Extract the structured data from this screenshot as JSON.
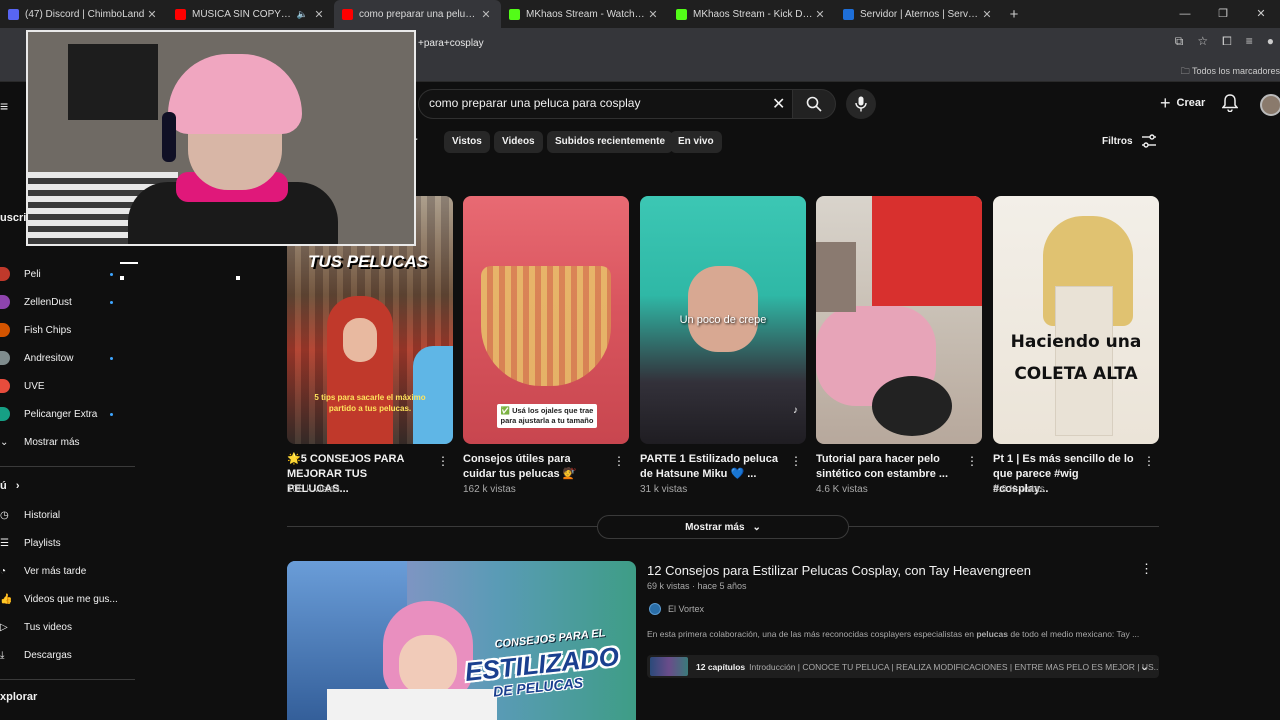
{
  "browser": {
    "tabs": [
      {
        "title": "(47) Discord | ChimboLand",
        "color": "#5865f2"
      },
      {
        "title": "MÚSICA SIN COPYRIGHT",
        "color": "#ff0000",
        "muted": true
      },
      {
        "title": "como preparar una peluca para cosplay",
        "color": "#ff0000",
        "active": true
      },
      {
        "title": "MKhaos Stream - Watch Live on Kick",
        "color": "#53fc18"
      },
      {
        "title": "MKhaos Stream - Kick Dashboard",
        "color": "#53fc18"
      },
      {
        "title": "Servidor | Aternos | Servidor de Minecraft",
        "color": "#1e6fd9"
      }
    ],
    "new_tab": "+",
    "url_visible": "+para+cosplay",
    "bookmarks_all": "Todos los marcadores"
  },
  "header": {
    "search_query": "como preparar una peluca para cosplay",
    "create_label": "Crear"
  },
  "chips": [
    "rar",
    "Vistos",
    "Videos",
    "Subidos recientemente",
    "En vivo"
  ],
  "filters_label": "Filtros",
  "sidebar": {
    "subs_header": "uscrip",
    "subscriptions": [
      {
        "name": "Peli",
        "color": "#c0392b",
        "new": true
      },
      {
        "name": "ZellenDust",
        "color": "#8e44ad",
        "new": true
      },
      {
        "name": "Fish Chips",
        "color": "#d35400",
        "new": false
      },
      {
        "name": "Andresitow",
        "color": "#7f8c8d",
        "new": true
      },
      {
        "name": "UVE",
        "color": "#e74c3c",
        "new": false
      },
      {
        "name": "Pelicanger Extra",
        "color": "#16a085",
        "new": true
      }
    ],
    "show_more": "Mostrar más",
    "you_header": "ú",
    "you_items": [
      "Historial",
      "Playlists",
      "Ver más tarde",
      "Videos que me gus...",
      "Tus videos",
      "Descargas"
    ],
    "explore_header": "xplorar"
  },
  "shorts": [
    {
      "title": "🌟5 CONSEJOS PARA MEJORAR TUS PELUCAS...",
      "views": "108 k vistas",
      "caption_top": "TUS PELUCAS",
      "caption_bottom": "5 tips para sacarle el máximo partido a tus pelucas."
    },
    {
      "title": "Consejos útiles para cuidar tus pelucas 💇",
      "views": "162 k vistas",
      "caption_bottom": "✅ Usá los ojales que trae para ajustarla a tu tamaño"
    },
    {
      "title": "PARTE 1 Estilizado peluca de Hatsune Miku 💙 ...",
      "views": "31 k vistas",
      "caption_mid": "Un poco de crepe"
    },
    {
      "title": "Tutorial para hacer pelo sintético con estambre ...",
      "views": "4.6 K vistas"
    },
    {
      "title": "Pt 1 | Es más sencillo de lo que parece #wig #cosplay...",
      "views": "5.9 K vistas",
      "caption_mid": "Haciendo una COLETA ALTA"
    }
  ],
  "show_more_results": "Mostrar más",
  "long_video": {
    "title": "12 Consejos para Estilizar Pelucas Cosplay, con Tay Heavengreen",
    "meta": "69 k vistas · hace 5 años",
    "channel": "El Vortex",
    "description_pre": "En esta primera colaboración, una de las más reconocidas cosplayers especialistas en ",
    "description_bold": "pelucas",
    "description_post": " de todo el medio mexicano: Tay ...",
    "chapters_count": "12 capítulos",
    "chapters_text": "Introducción | CONOCE TU PELUCA | REALIZA MODIFICACIONES | ENTRE MAS PELO ES MEJOR | US...",
    "thumb_caption_1": "CONSEJOS PARA EL",
    "thumb_caption_2": "ESTILIZADO",
    "thumb_caption_3": "DE PELUCAS"
  }
}
